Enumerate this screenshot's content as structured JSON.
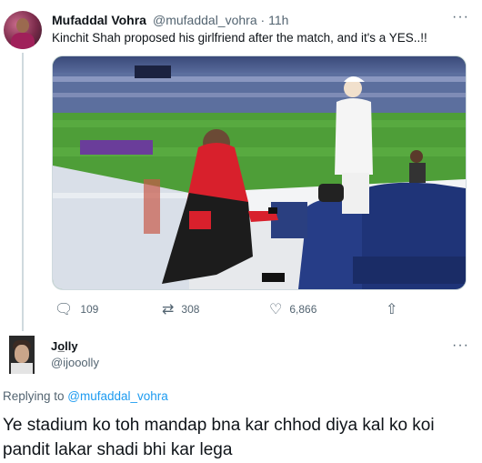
{
  "tweet": {
    "author_name": "Mufaddal Vohra",
    "author_handle": "@mufaddal_vohra",
    "separator": "·",
    "time": "11h",
    "text": "Kinchit Shah proposed his girlfriend after the match, and it's a YES..!!",
    "more": "···",
    "stats": {
      "replies": "109",
      "retweets": "308",
      "likes": "6,866"
    },
    "icons": {
      "reply": "reply-icon",
      "retweet": "retweet-icon",
      "like": "heart-icon",
      "share": "share-icon"
    }
  },
  "reply_tweet": {
    "author_name": "Jo̲lly",
    "author_handle": "@ijooolly",
    "replying_to_prefix": "Replying to ",
    "replying_to_handle": "@mufaddal_vohra",
    "text": "Ye stadium ko toh mandap bna kar chhod diya kal ko koi pandit lakar shadi bhi kar lega",
    "more": "···"
  },
  "colors": {
    "link": "#1d9bf0",
    "muted": "#536471",
    "text": "#0f1419",
    "line": "#cfd9de"
  }
}
